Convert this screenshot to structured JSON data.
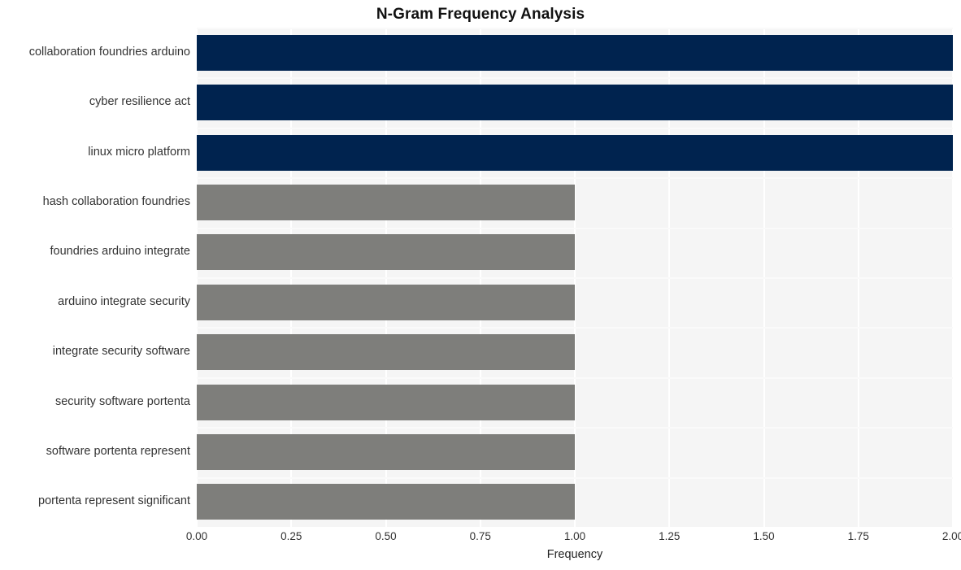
{
  "chart_data": {
    "type": "bar",
    "orientation": "horizontal",
    "title": "N-Gram Frequency Analysis",
    "xlabel": "Frequency",
    "ylabel": "",
    "xlim": [
      0,
      2
    ],
    "ylim": null,
    "grid": true,
    "legend": null,
    "xticks": [
      "0.00",
      "0.25",
      "0.50",
      "0.75",
      "1.00",
      "1.25",
      "1.50",
      "1.75",
      "2.00"
    ],
    "xtick_values": [
      0,
      0.25,
      0.5,
      0.75,
      1.0,
      1.25,
      1.5,
      1.75,
      2.0
    ],
    "categories": [
      "collaboration foundries arduino",
      "cyber resilience act",
      "linux micro platform",
      "hash collaboration foundries",
      "foundries arduino integrate",
      "arduino integrate security",
      "integrate security software",
      "security software portenta",
      "software portenta represent",
      "portenta represent significant"
    ],
    "values": [
      2,
      2,
      2,
      1,
      1,
      1,
      1,
      1,
      1,
      1
    ],
    "bar_colors": [
      "#00234f",
      "#00234f",
      "#00234f",
      "#7e7e7b",
      "#7e7e7b",
      "#7e7e7b",
      "#7e7e7b",
      "#7e7e7b",
      "#7e7e7b",
      "#7e7e7b"
    ],
    "colors": {
      "highlight": "#00234f",
      "normal": "#7e7e7b",
      "plot_background": "#f5f5f5",
      "figure_background": "#ffffff",
      "gridline": "#ffffff",
      "title_text": "#121212",
      "tick_text": "#333333"
    }
  }
}
